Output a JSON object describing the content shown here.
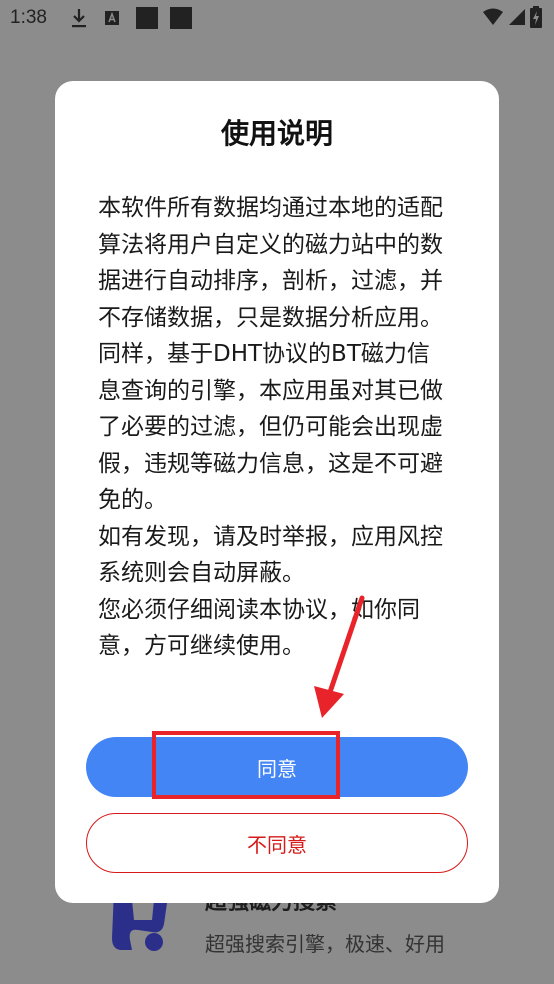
{
  "status_bar": {
    "time": "1:38"
  },
  "background_app": {
    "title": "超强磁力搜索",
    "subtitle": "超强搜索引擎，极速、好用"
  },
  "dialog": {
    "title": "使用说明",
    "paragraphs": [
      "本软件所有数据均通过本地的适配算法将用户自定义的磁力站中的数据进行自动排序，剖析，过滤，并不存储数据，只是数据分析应用。",
      "同样，基于DHT协议的BT磁力信息查询的引擎，本应用虽对其已做了必要的过滤，但仍可能会出现虚假，违规等磁力信息，这是不可避免的。",
      "如有发现，请及时举报，应用风控系统则会自动屏蔽。",
      "您必须仔细阅读本协议，如你同意，方可继续使用。"
    ],
    "agree_label": "同意",
    "disagree_label": "不同意"
  },
  "colors": {
    "agree_bg": "#4485f6",
    "disagree_border": "#d71919",
    "annotation": "#e8232a"
  }
}
